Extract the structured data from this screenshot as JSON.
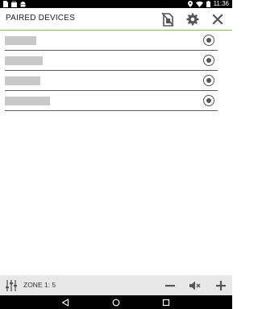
{
  "status_bar": {
    "time": "11:36",
    "left_icons": [
      "sim-icon",
      "shopping-bag-icon",
      "android-icon"
    ],
    "right_icons": [
      "location-icon",
      "wifi-icon",
      "battery-icon"
    ]
  },
  "header": {
    "title": "PAIRED DEVICES",
    "accent_color": "#8bc34a",
    "actions": [
      "no-sim-card-icon",
      "gear-icon",
      "close-icon"
    ]
  },
  "devices": [
    {
      "name": "",
      "selected": false
    },
    {
      "name": "",
      "selected": false
    },
    {
      "name": "",
      "selected": false
    },
    {
      "name": "",
      "selected": false
    }
  ],
  "bottom_bar": {
    "zone_label": "ZONE 1: 5",
    "icons": [
      "equalizer-icon",
      "volume-down-icon",
      "mute-icon",
      "volume-up-icon"
    ]
  },
  "nav_bar": {
    "buttons": [
      "back-icon",
      "home-icon",
      "recents-icon"
    ]
  }
}
